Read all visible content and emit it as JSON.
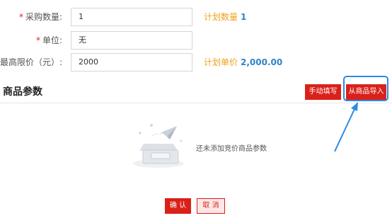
{
  "form": {
    "quantity": {
      "label": "采购数量:",
      "value": "1",
      "hint_label": "计划数量",
      "hint_value": "1"
    },
    "unit": {
      "label": "单位:",
      "value": "无"
    },
    "max_price": {
      "label": "最高限价（元）:",
      "value": "2000",
      "hint_label": "计划单价",
      "hint_value": "2,000.00"
    }
  },
  "required_mark": "*",
  "params": {
    "title": "商品参数",
    "manual_button": "手动填写",
    "import_button": "从商品导入",
    "empty_text": "还未添加竞价商品参数"
  },
  "footer": {
    "confirm": "确 认",
    "cancel": "取 消"
  },
  "colors": {
    "accent_red": "#d9211a",
    "highlight_blue": "#2b8ae6",
    "hint_orange": "#f0a11a",
    "hint_number_blue": "#2f83c6"
  }
}
